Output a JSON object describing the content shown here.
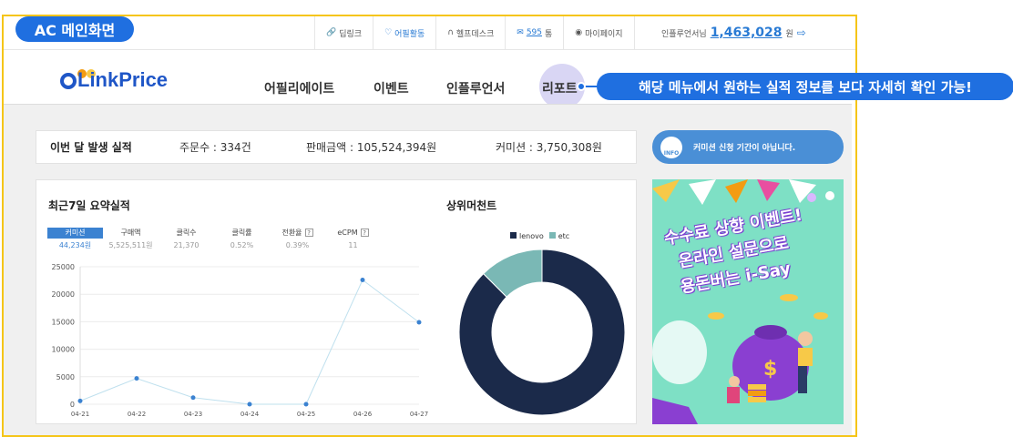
{
  "annotation": {
    "label": "AC 메인화면",
    "callout": "해당 메뉴에서 원하는 실적 정보를 보다 자세히 확인 가능!"
  },
  "topbar": {
    "links": [
      {
        "icon": "link-icon",
        "label": "딥링크"
      },
      {
        "icon": "lightbulb-icon",
        "label": "어필활동"
      },
      {
        "icon": "headset-icon",
        "label": "헬프데스크"
      },
      {
        "icon": "mail-icon",
        "count": "595",
        "suffix": "통"
      },
      {
        "icon": "user-circle-icon",
        "label": "마이페이지"
      }
    ],
    "user_label": "인플루언서님",
    "points": "1,463,028",
    "points_unit": "원",
    "logout_icon": "logout-icon"
  },
  "logo": {
    "text": "LinkPrice"
  },
  "nav": [
    "어필리에이트",
    "이벤트",
    "인플루언서",
    "리포트"
  ],
  "summary": {
    "title": "이번 달 발생 실적",
    "orders": "주문수 : 334건",
    "sales": "판매금액 : 105,524,394원",
    "commission": "커미션 : 3,750,308원"
  },
  "info": {
    "icon_text": "INFO",
    "text": "커미션 신청 기간이 아닙니다."
  },
  "weekly": {
    "title": "최근7일 요약실적",
    "stats": [
      {
        "label": "커미션",
        "value": "44,234원",
        "active": true
      },
      {
        "label": "구매액",
        "value": "5,525,511원"
      },
      {
        "label": "클릭수",
        "value": "21,370"
      },
      {
        "label": "클릭률",
        "value": "0.52%"
      },
      {
        "label": "전환율",
        "value": "0.39%",
        "help": "?"
      },
      {
        "label": "eCPM",
        "value": "11",
        "help": "?"
      }
    ]
  },
  "merchants": {
    "title": "상위머천트"
  },
  "banner": {
    "line1": "수수료 상향 이벤트!",
    "line2": "온라인 설문으로",
    "line3": "용돈버는 i-Say"
  },
  "colors": {
    "accent": "#1f6fe0",
    "frame": "#f5c518",
    "donut_dark": "#1b2a4a",
    "donut_light": "#7ab8b5",
    "line": "#bfe0ee",
    "point": "#3b82d1"
  },
  "chart_data": [
    {
      "type": "line",
      "x": [
        "04-21",
        "04-22",
        "04-23",
        "04-24",
        "04-25",
        "04-26",
        "04-27"
      ],
      "series": [
        {
          "values": [
            600,
            4700,
            1200,
            0,
            0,
            22600,
            14900
          ]
        }
      ],
      "ylim": [
        0,
        25000
      ],
      "yticks": [
        0,
        5000,
        10000,
        15000,
        20000,
        25000
      ],
      "grid": true
    },
    {
      "type": "pie",
      "donut": true,
      "legend": "top",
      "categories": [
        "lenovo",
        "etc"
      ],
      "values": [
        87.5,
        12.5
      ]
    }
  ]
}
